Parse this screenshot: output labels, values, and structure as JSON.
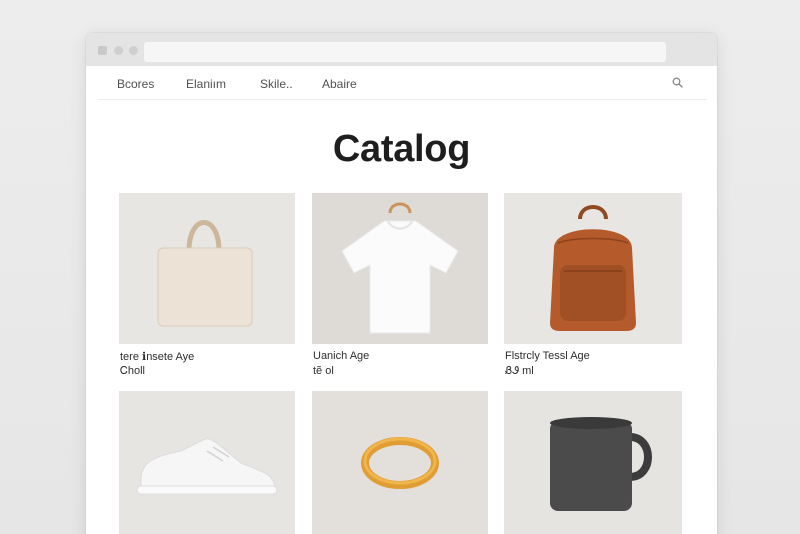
{
  "nav": {
    "items": [
      {
        "label": "Bcores"
      },
      {
        "label": "Elaniım"
      },
      {
        "label": "Skile.."
      },
      {
        "label": "Abaire"
      }
    ]
  },
  "page": {
    "title": "Catalog"
  },
  "products": [
    {
      "name": "tere ℹnsete Aye",
      "price": "Ꮯholl",
      "icon": "tote-bag"
    },
    {
      "name": "Uanich Age",
      "price": "tẽ ol",
      "icon": "tshirt"
    },
    {
      "name": "Flstrcly Tessl Age",
      "price": "ᏰᏭ ml",
      "icon": "backpack"
    },
    {
      "name": "",
      "price": "",
      "icon": "sneaker"
    },
    {
      "name": "",
      "price": "",
      "icon": "bangle"
    },
    {
      "name": "",
      "price": "",
      "icon": "mug"
    }
  ],
  "colors": {
    "background": "#e9e9e9",
    "window": "#ffffff",
    "chrome": "#e4e4e4",
    "title": "#1e1e1e",
    "thumb_bg": "#e7e5e2"
  }
}
